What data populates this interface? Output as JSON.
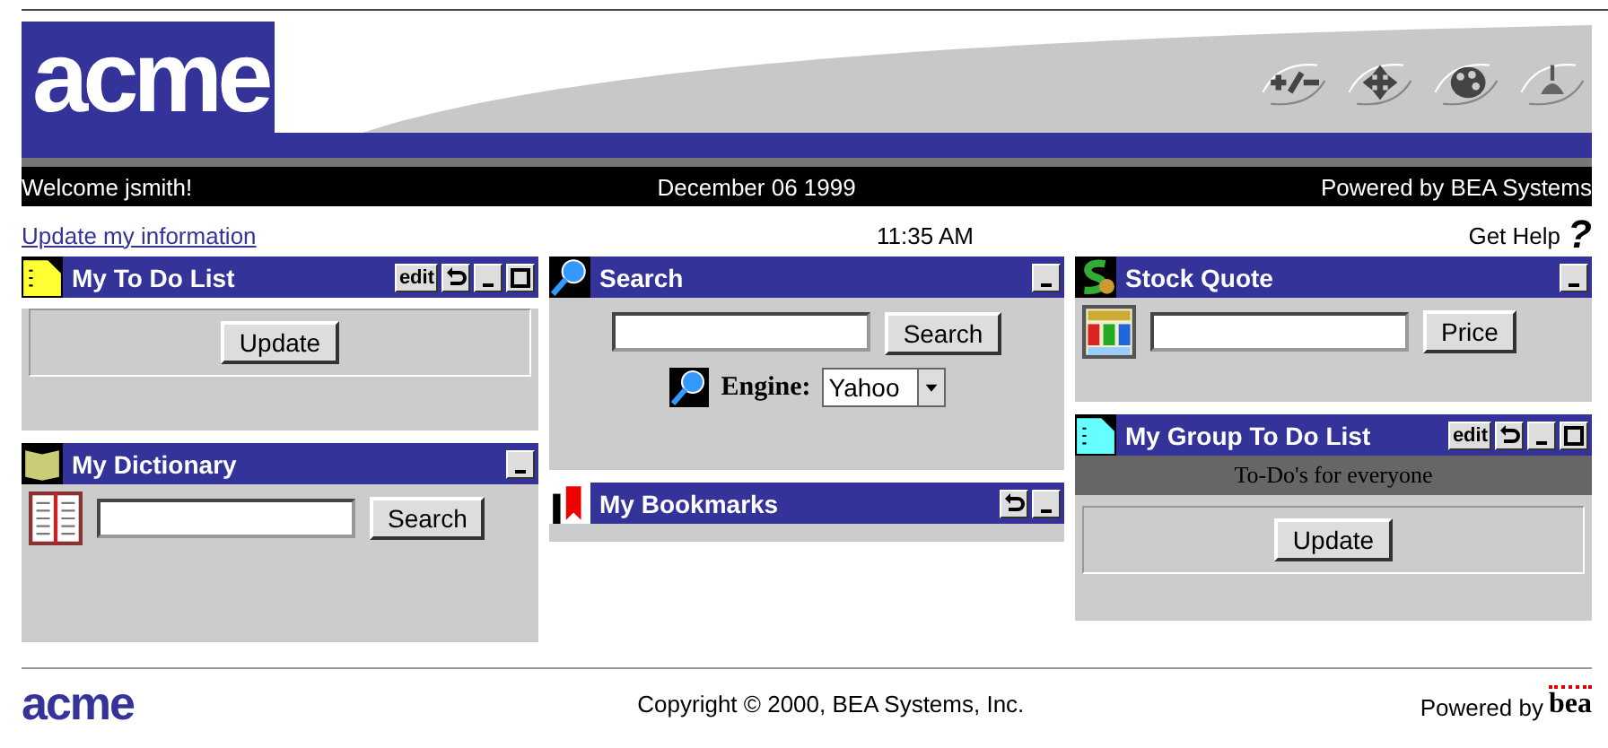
{
  "header": {
    "logo": "acme",
    "welcome": "Welcome jsmith!",
    "date": "December 06 1999",
    "powered": "Powered by BEA Systems"
  },
  "info_row": {
    "link": "Update my information",
    "time": "11:35 AM",
    "help": "Get Help",
    "help_icon": "?"
  },
  "columns": [
    {
      "portlets": [
        {
          "title": "My To Do List",
          "controls": [
            {
              "kind": "edit",
              "label": "edit"
            },
            {
              "kind": "undo"
            },
            {
              "kind": "minimize"
            },
            {
              "kind": "maximize"
            }
          ],
          "body": {
            "kind": "update",
            "button": "Update"
          }
        },
        {
          "title": "My Dictionary",
          "controls": [
            {
              "kind": "minimize"
            }
          ],
          "body": {
            "kind": "lookup",
            "button": "Search"
          }
        }
      ]
    },
    {
      "portlets": [
        {
          "title": "Search",
          "controls": [
            {
              "kind": "minimize"
            }
          ],
          "body": {
            "kind": "search",
            "button": "Search",
            "engine_label": "Engine:",
            "engine": "Yahoo"
          }
        },
        {
          "title": "My Bookmarks",
          "controls": [
            {
              "kind": "undo"
            },
            {
              "kind": "minimize"
            }
          ],
          "body": {
            "kind": "empty"
          }
        }
      ]
    },
    {
      "portlets": [
        {
          "title": "Stock Quote",
          "controls": [
            {
              "kind": "minimize"
            }
          ],
          "body": {
            "kind": "lookup",
            "button": "Price"
          }
        },
        {
          "title": "My Group To Do List",
          "controls": [
            {
              "kind": "edit",
              "label": "edit"
            },
            {
              "kind": "undo"
            },
            {
              "kind": "minimize"
            },
            {
              "kind": "maximize"
            }
          ],
          "body": {
            "kind": "group",
            "banner": "To-Do's for everyone",
            "button": "Update"
          }
        }
      ]
    }
  ],
  "footer": {
    "logo": "acme",
    "copyright": "Copyright © 2000, BEA Systems, Inc.",
    "powered": "Powered by",
    "brand": "bea"
  }
}
